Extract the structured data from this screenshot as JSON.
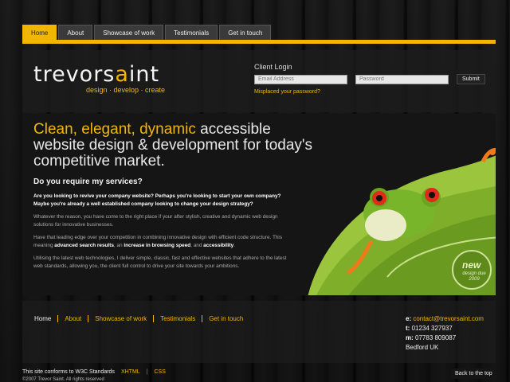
{
  "nav": {
    "tabs": [
      {
        "label": "Home",
        "active": true
      },
      {
        "label": "About",
        "active": false
      },
      {
        "label": "Showcase of work",
        "active": false
      },
      {
        "label": "Testimonials",
        "active": false
      },
      {
        "label": "Get in touch",
        "active": false
      }
    ]
  },
  "brand": {
    "logo_part1": "trevors",
    "logo_accent": "a",
    "logo_part2": "int",
    "tagline": "design · develop · create",
    "accent_color": "#f2b600"
  },
  "login": {
    "title": "Client Login",
    "email_placeholder": "Email Address",
    "password_placeholder": "Password",
    "submit_label": "Submit",
    "forgot_link": "Misplaced your password?"
  },
  "hero": {
    "headline_highlight": "Clean, elegant, dynamic",
    "headline_rest": " accessible website design & development for today's competitive market."
  },
  "services": {
    "title": "Do you require my services?",
    "intro": "Are you looking to revive your company website? Perhaps you're looking to start your own company? Maybe you're already a well established company looking to change your design strategy?",
    "para1": "Whatever the reason, you have come to the right place if your after stylish, creative and dynamic web design solutions for innovative businesses.",
    "para2_a": "Have that leading edge over your competition in combining innovative design with efficient code structure. This meaning ",
    "para2_b1": "advanced search results",
    "para2_c": ", an ",
    "para2_b2": "increase in browsing speed",
    "para2_d": ", and ",
    "para2_b3": "accessibility",
    "para2_e": ".",
    "para3": "Utilising the latest web technologies, I deliver simple, classic, fast and effective websites that adhere to the latest web standards, allowing you, the client full control to drive your site towards your ambitions."
  },
  "badge": {
    "label": "new",
    "sub": "design due 2009"
  },
  "footer": {
    "links": [
      "Home",
      "About",
      "Showcase of work",
      "Testimonials",
      "Get in touch"
    ],
    "email_label": "e:",
    "email": "contact@trevorsaint.com",
    "tel_label": "t:",
    "tel": "01234 327937",
    "mob_label": "m:",
    "mob": "07783 809087",
    "location": "Bedford UK"
  },
  "bottom": {
    "standards": "This site conforms to W3C Standards",
    "xhtml": "XHTML",
    "css": "CSS",
    "copyright": "©2007 Trevor Saint. All rights reserved",
    "back_to_top": "Back to the top"
  }
}
